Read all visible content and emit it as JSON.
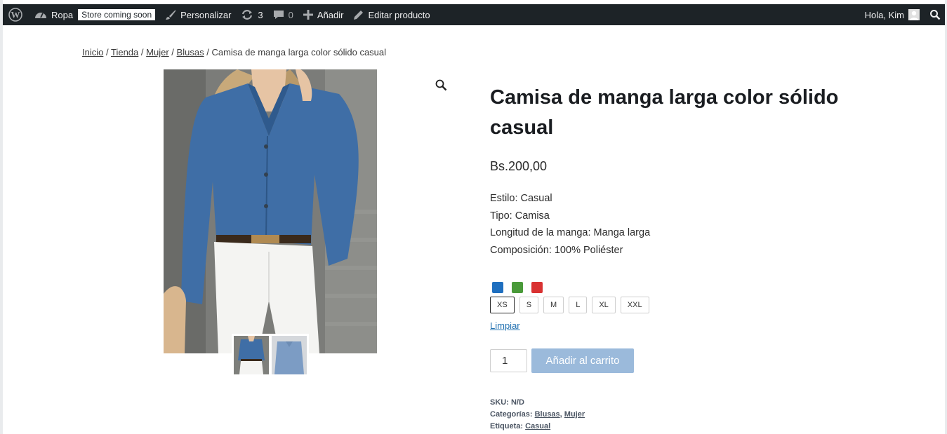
{
  "admin_bar": {
    "site_name": "Ropa",
    "store_badge": "Store coming soon",
    "customize": "Personalizar",
    "updates_count": "3",
    "comments_count": "0",
    "add_new": "Añadir",
    "edit_product": "Editar producto",
    "greeting": "Hola, Kim",
    "icons": [
      "wordpress-logo-icon",
      "dashboard-icon",
      "brush-icon",
      "updates-icon",
      "comment-icon",
      "plus-icon",
      "pencil-icon",
      "user-avatar-icon",
      "search-icon"
    ]
  },
  "breadcrumb": {
    "items": [
      "Inicio",
      "Tienda",
      "Mujer",
      "Blusas"
    ],
    "separator": "/",
    "current": "Camisa de manga larga color sólido casual"
  },
  "product": {
    "title": "Camisa de manga larga color sólido casual",
    "price": "Bs.200,00",
    "description": [
      "Estilo: Casual",
      "Tipo: Camisa",
      "Longitud de la manga: Manga larga",
      "Composición: 100% Poliéster"
    ],
    "colors": [
      "#1f6fbf",
      "#4a9a3a",
      "#d93232"
    ],
    "sizes": [
      "XS",
      "S",
      "M",
      "L",
      "XL",
      "XXL"
    ],
    "selected_size": "XS",
    "clear_label": "Limpiar",
    "quantity": "1",
    "add_to_cart": "Añadir al carrito",
    "meta": {
      "sku_label": "SKU:",
      "sku_value": "N/D",
      "categories_label": "Categorías:",
      "categories": [
        "Blusas",
        "Mujer"
      ],
      "tag_label": "Etiqueta:",
      "tag": "Casual"
    }
  },
  "colors": {
    "admin_bar_bg": "#1d2327",
    "add_to_cart_bg": "#9bbadb",
    "link": "#2271b1"
  }
}
